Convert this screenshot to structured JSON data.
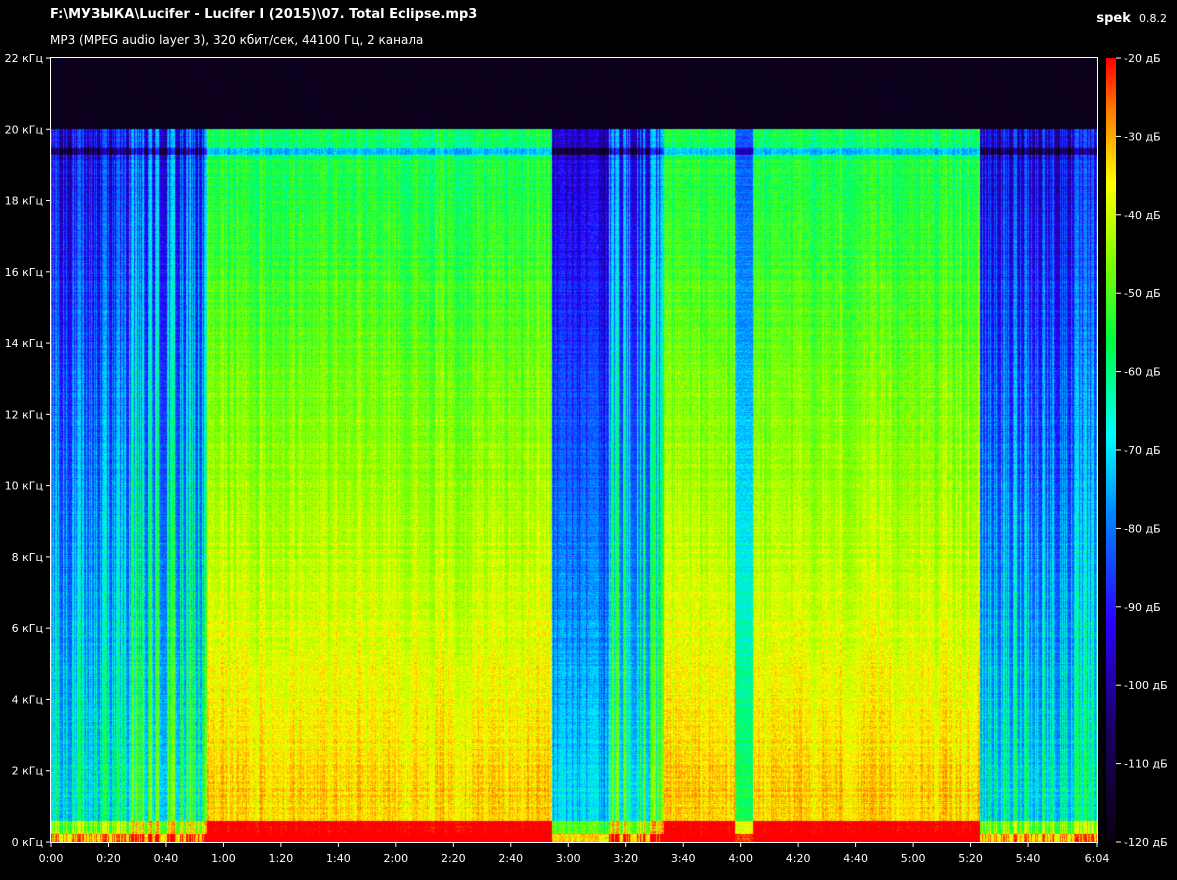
{
  "header": {
    "file_path": "F:\\МУЗЫКА\\Lucifer - Lucifer I (2015)\\07. Total Eclipse.mp3",
    "audio_info": "MP3 (MPEG audio layer 3), 320 кбит/сек, 44100 Гц, 2 канала",
    "app_name": "spek",
    "app_version": "0.8.2"
  },
  "colors": {
    "background": "#000000",
    "text": "#ffffff",
    "axis": "#ffffff",
    "palette_low": "#0a000f",
    "palette_mid_low": "#1a00ff",
    "palette_mid": "#00ffff",
    "palette_mid_high": "#00ff00",
    "palette_high": "#ffff00",
    "palette_top": "#ff0000"
  },
  "chart_data": {
    "type": "heatmap",
    "title": "",
    "xlabel": "",
    "ylabel": "",
    "x_range_seconds": [
      0,
      364
    ],
    "y_range_khz": [
      0,
      22
    ],
    "x_ticks": [
      "0:00",
      "0:20",
      "0:40",
      "1:00",
      "1:20",
      "1:40",
      "2:00",
      "2:20",
      "2:40",
      "3:00",
      "3:20",
      "3:40",
      "4:00",
      "4:20",
      "4:40",
      "5:00",
      "5:20",
      "5:40",
      "6:04"
    ],
    "x_tick_values_seconds": [
      0,
      20,
      40,
      60,
      80,
      100,
      120,
      140,
      160,
      180,
      200,
      220,
      240,
      260,
      280,
      300,
      320,
      340,
      364
    ],
    "y_ticks": [
      "0 кГц",
      "2 кГц",
      "4 кГц",
      "6 кГц",
      "8 кГц",
      "10 кГц",
      "12 кГц",
      "14 кГц",
      "16 кГц",
      "18 кГц",
      "20 кГц",
      "22 кГц"
    ],
    "y_tick_values_khz": [
      0,
      2,
      4,
      6,
      8,
      10,
      12,
      14,
      16,
      18,
      20,
      22
    ],
    "colorbar_ticks": [
      "-20 дБ",
      "-30 дБ",
      "-40 дБ",
      "-50 дБ",
      "-60 дБ",
      "-70 дБ",
      "-80 дБ",
      "-90 дБ",
      "-100 дБ",
      "-110 дБ",
      "-120 дБ"
    ],
    "colorbar_values_db": [
      -20,
      -30,
      -40,
      -50,
      -60,
      -70,
      -80,
      -90,
      -100,
      -110,
      -120
    ],
    "db_range": [
      -120,
      -20
    ],
    "cutoff_khz": 20,
    "sections": [
      {
        "start_s": 0,
        "end_s": 27,
        "level": "sparse"
      },
      {
        "start_s": 27,
        "end_s": 54,
        "level": "mid"
      },
      {
        "start_s": 54,
        "end_s": 174,
        "level": "loud"
      },
      {
        "start_s": 174,
        "end_s": 194,
        "level": "quiet"
      },
      {
        "start_s": 194,
        "end_s": 213,
        "level": "mid"
      },
      {
        "start_s": 213,
        "end_s": 238,
        "level": "loud"
      },
      {
        "start_s": 238,
        "end_s": 244,
        "level": "dip"
      },
      {
        "start_s": 244,
        "end_s": 323,
        "level": "loud"
      },
      {
        "start_s": 323,
        "end_s": 364,
        "level": "sparse"
      }
    ]
  }
}
